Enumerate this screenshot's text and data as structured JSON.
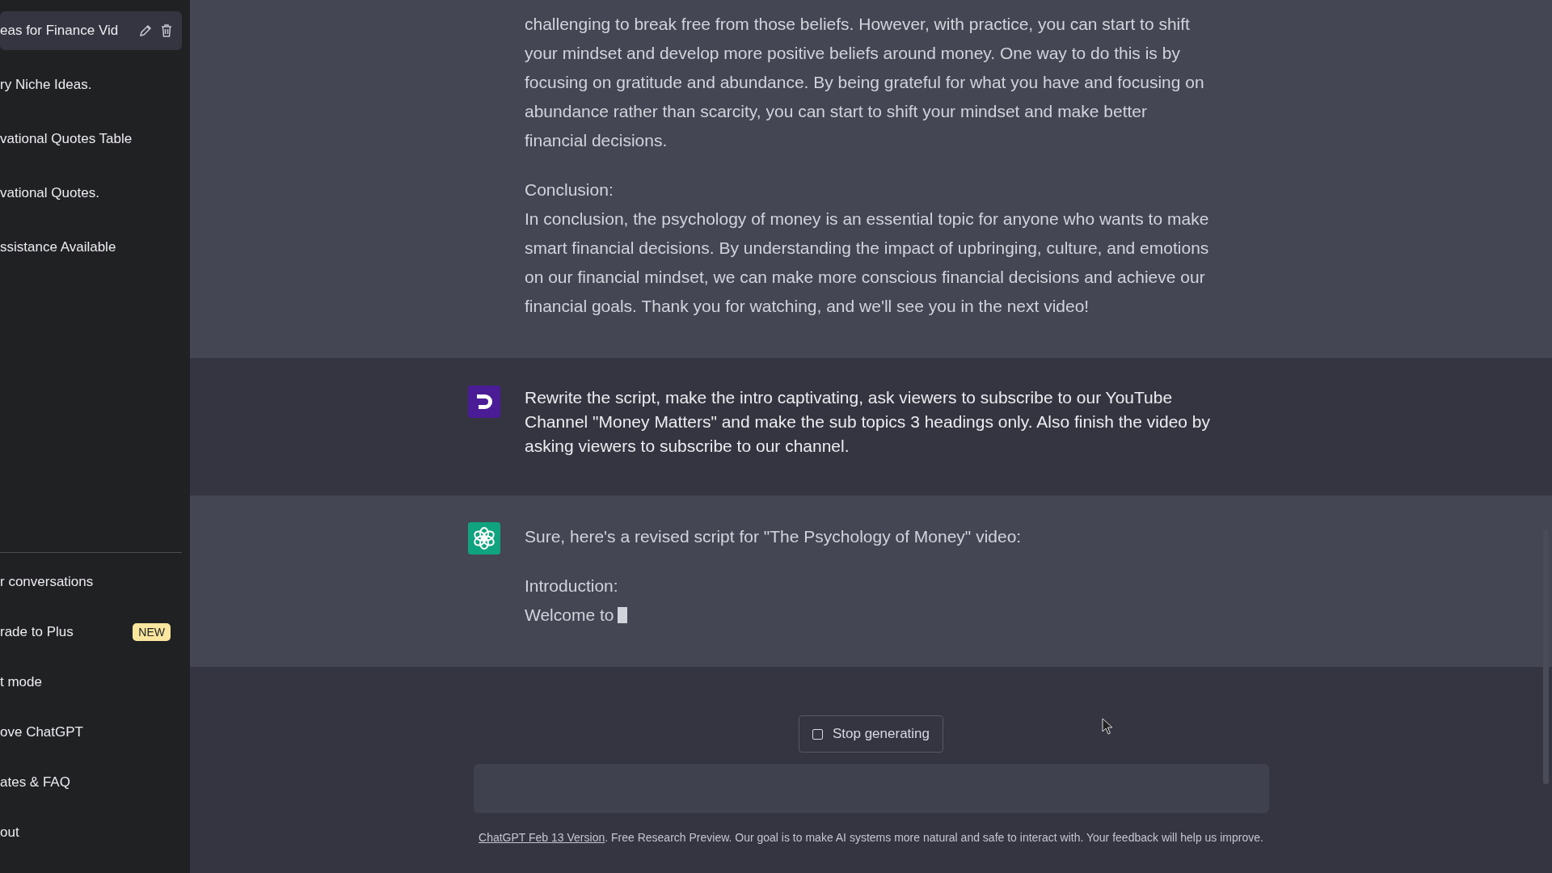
{
  "sidebar": {
    "conversations": [
      {
        "title": "eas for Finance Vid",
        "selected": true
      },
      {
        "title": "ry Niche Ideas.",
        "selected": false
      },
      {
        "title": "vational Quotes Table",
        "selected": false
      },
      {
        "title": "vational Quotes.",
        "selected": false
      },
      {
        "title": "ssistance Available",
        "selected": false
      }
    ],
    "menu": [
      {
        "label": "r conversations"
      },
      {
        "label": "rade to Plus",
        "badge": "NEW"
      },
      {
        "label": "t mode"
      },
      {
        "label": "ove ChatGPT"
      },
      {
        "label": "ates & FAQ"
      },
      {
        "label": "out"
      }
    ]
  },
  "messages": [
    {
      "kind": "continuation",
      "streaming": false,
      "blocks": [
        [
          "challenging to break free from those beliefs. However, with practice, you can start to shift your mindset and develop more positive beliefs around money. One way to do this is by focusing on gratitude and abundance. By being grateful for what you have and focusing on abundance rather than scarcity, you can start to shift your mindset and make better financial decisions."
        ],
        [
          "Conclusion:",
          "In conclusion, the psychology of money is an essential topic for anyone who wants to make smart financial decisions. By understanding the impact of upbringing, culture, and emotions on our financial mindset, we can make more conscious financial decisions and achieve our financial goals. Thank you for watching, and we'll see you in the next video!"
        ]
      ]
    },
    {
      "kind": "user",
      "streaming": false,
      "blocks": [
        [
          "Rewrite the script, make the intro captivating, ask viewers to subscribe to our YouTube Channel \"Money Matters\" and make the sub topics 3 headings only. Also finish the video by asking viewers to subscribe to our channel."
        ]
      ]
    },
    {
      "kind": "assistant",
      "streaming": true,
      "blocks": [
        [
          "Sure, here's a revised script for \"The Psychology of Money\" video:"
        ],
        [
          "Introduction:",
          "Welcome to"
        ]
      ]
    }
  ],
  "stop_button": "Stop generating",
  "footer": {
    "link": "ChatGPT Feb 13 Version",
    "text": ". Free Research Preview. Our goal is to make AI systems more natural and safe to interact with. Your feedback will help us improve."
  }
}
